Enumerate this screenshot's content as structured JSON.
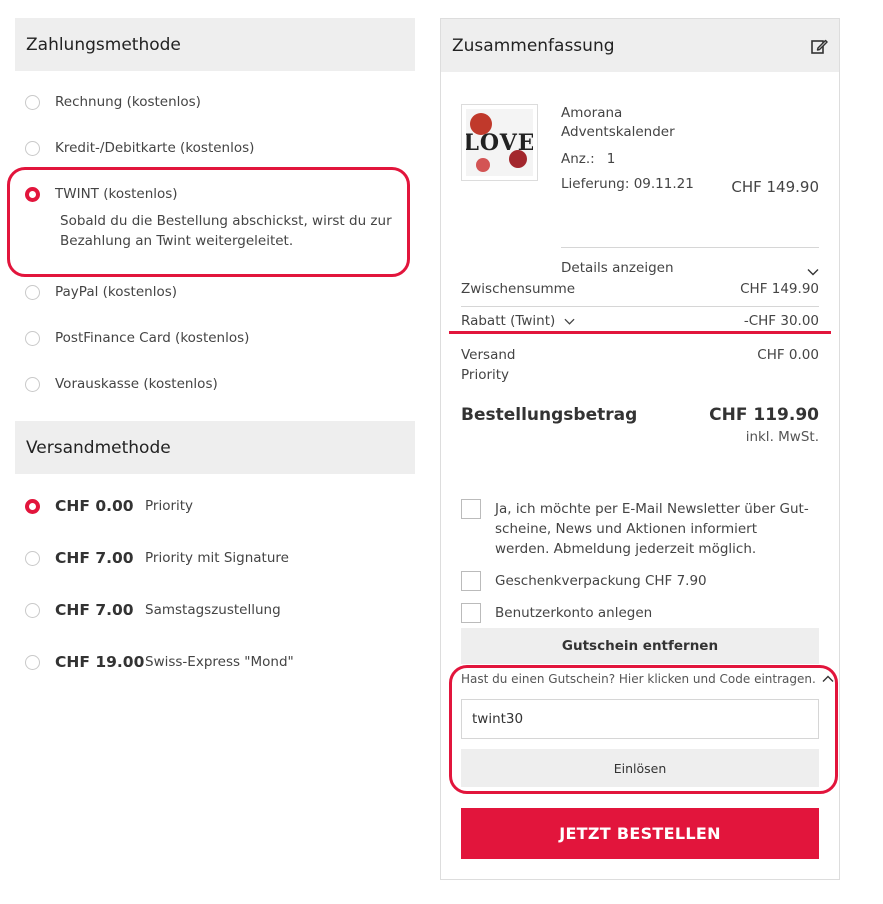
{
  "payment": {
    "title": "Zahlungsmethode",
    "options": [
      {
        "label": "Rechnung (kostenlos)",
        "selected": false
      },
      {
        "label": "Kredit-/Debitkarte (kostenlos)",
        "selected": false
      },
      {
        "label": "TWINT (kostenlos)",
        "selected": true,
        "description": "Sobald du die Bestellung abschickst, wirst du zur Bezahlung an Twint weitergeleitet."
      },
      {
        "label": "PayPal (kostenlos)",
        "selected": false
      },
      {
        "label": "PostFinance Card (kostenlos)",
        "selected": false
      },
      {
        "label": "Vorauskasse (kostenlos)",
        "selected": false
      }
    ]
  },
  "shipping": {
    "title": "Versandmethode",
    "options": [
      {
        "price": "CHF 0.00",
        "name": "Priority",
        "selected": true
      },
      {
        "price": "CHF 7.00",
        "name": "Priority mit Signature",
        "selected": false
      },
      {
        "price": "CHF 7.00",
        "name": "Samstagszustellung",
        "selected": false
      },
      {
        "price": "CHF 19.00",
        "name": "Swiss-Express \"Mond\"",
        "selected": false
      }
    ]
  },
  "summary": {
    "title": "Zusammenfassung",
    "product": {
      "image_text": "LOVE",
      "brand": "Amorana",
      "name": "Adventskalender",
      "qty_label": "Anz.:",
      "qty": "1",
      "delivery": "Lieferung: 09.11.21",
      "price": "CHF 149.90",
      "details_label": "Details anzeigen"
    },
    "subtotal_label": "Zwischensumme",
    "subtotal": "CHF 149.90",
    "discount_label": "Rabatt (Twint)",
    "discount": "-CHF 30.00",
    "shipping_label": "Versand",
    "shipping_method": "Priority",
    "shipping_cost": "CHF 0.00",
    "total_label": "Bestellungsbetrag",
    "total": "CHF 119.90",
    "tax_note": "inkl. MwSt.",
    "newsletter": "Ja, ich möchte per E-Mail Newsletter über Gut-scheine, News und Aktionen informiert werden. Abmeldung jederzeit möglich.",
    "giftwrap": "Geschenkverpackung CHF 7.90",
    "account": "Benutzerkonto anlegen",
    "remove_voucher": "Gutschein entfernen",
    "voucher_hint": "Hast du einen Gutschein? Hier klicken und Code eintragen.",
    "voucher_code": "twint30",
    "redeem": "Einlösen",
    "order_button": "JETZT BESTELLEN"
  },
  "colors": {
    "accent": "#e2153c",
    "panel": "#eeeeee"
  }
}
